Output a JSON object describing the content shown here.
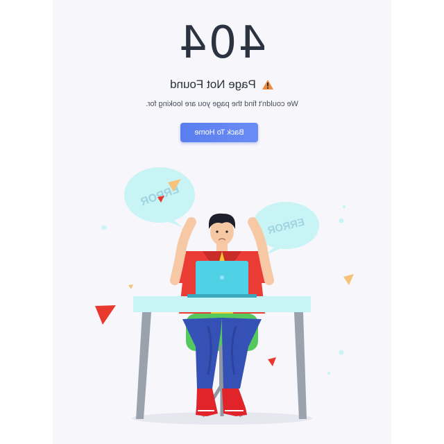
{
  "error": {
    "code": "404",
    "title": "Page Not Found",
    "message": "We couldn't find the page you are looking for."
  },
  "actions": {
    "home_label": "Back To Home"
  },
  "illustration": {
    "bubble_left_text": "ERROR",
    "bubble_right_text": "ERROR"
  },
  "icons": {
    "warning": "warning-icon"
  },
  "colors": {
    "accent": "#5a7ef0",
    "heading": "#2b3340",
    "bubble": "#c8f4f6",
    "warning": "#f08a3c"
  }
}
